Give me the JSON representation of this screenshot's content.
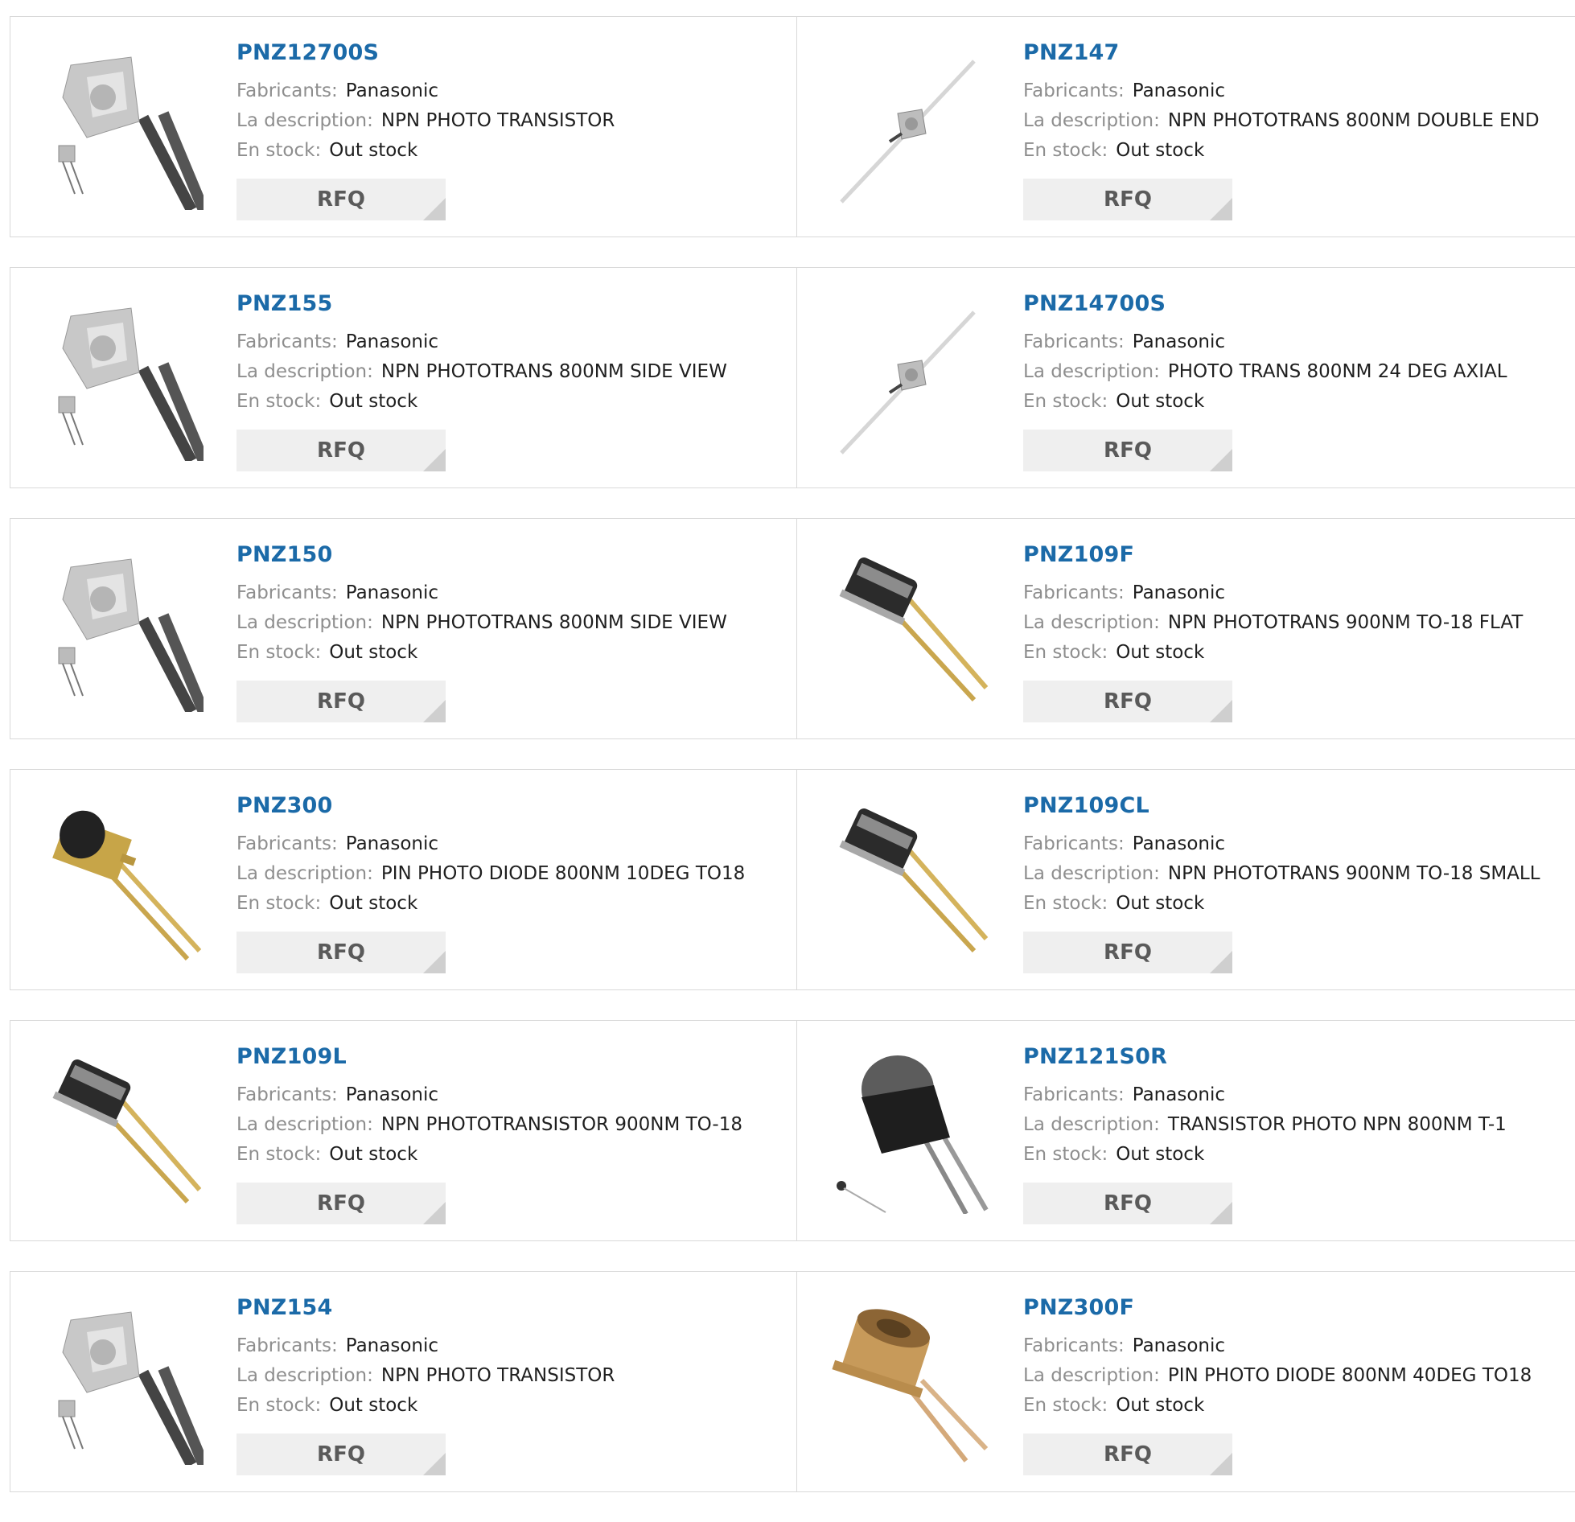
{
  "labels": {
    "manufacturer": "Fabricants:",
    "description": "La description:",
    "stock": "En stock:",
    "rfq": "RFQ"
  },
  "colors": {
    "part_link": "#1b6aa8",
    "label": "#8e8e8e",
    "value": "#1f1f1f",
    "rfq_bg": "#efefef",
    "border": "#d9d9d9"
  },
  "products": [
    {
      "part": "PNZ12700S",
      "manufacturer": "Panasonic",
      "description": "NPN PHOTO TRANSISTOR",
      "stock": "Out stock",
      "image": "side-view-photo-transistor-icon"
    },
    {
      "part": "PNZ147",
      "manufacturer": "Panasonic",
      "description": "NPN PHOTOTRANS 800NM DOUBLE END",
      "stock": "Out stock",
      "image": "axial-phototransistor-icon"
    },
    {
      "part": "PNZ155",
      "manufacturer": "Panasonic",
      "description": "NPN PHOTOTRANS 800NM SIDE VIEW",
      "stock": "Out stock",
      "image": "side-view-photo-transistor-icon"
    },
    {
      "part": "PNZ14700S",
      "manufacturer": "Panasonic",
      "description": "PHOTO TRANS 800NM 24 DEG AXIAL",
      "stock": "Out stock",
      "image": "axial-phototransistor-icon"
    },
    {
      "part": "PNZ150",
      "manufacturer": "Panasonic",
      "description": "NPN PHOTOTRANS 800NM SIDE VIEW",
      "stock": "Out stock",
      "image": "side-view-photo-transistor-icon"
    },
    {
      "part": "PNZ109F",
      "manufacturer": "Panasonic",
      "description": "NPN PHOTOTRANS 900NM TO-18 FLAT",
      "stock": "Out stock",
      "image": "to18-metal-can-icon"
    },
    {
      "part": "PNZ300",
      "manufacturer": "Panasonic",
      "description": "PIN PHOTO DIODE 800NM 10DEG TO18",
      "stock": "Out stock",
      "image": "to18-dome-lens-icon"
    },
    {
      "part": "PNZ109CL",
      "manufacturer": "Panasonic",
      "description": "NPN PHOTOTRANS 900NM TO-18 SMALL",
      "stock": "Out stock",
      "image": "to18-metal-can-icon"
    },
    {
      "part": "PNZ109L",
      "manufacturer": "Panasonic",
      "description": "NPN PHOTOTRANSISTOR 900NM TO-18",
      "stock": "Out stock",
      "image": "to18-metal-can-icon"
    },
    {
      "part": "PNZ121S0R",
      "manufacturer": "Panasonic",
      "description": "TRANSISTOR PHOTO NPN 800NM T-1",
      "stock": "Out stock",
      "image": "t1-dark-package-icon"
    },
    {
      "part": "PNZ154",
      "manufacturer": "Panasonic",
      "description": "NPN PHOTO TRANSISTOR",
      "stock": "Out stock",
      "image": "side-view-photo-transistor-icon"
    },
    {
      "part": "PNZ300F",
      "manufacturer": "Panasonic",
      "description": "PIN PHOTO DIODE 800NM 40DEG TO18",
      "stock": "Out stock",
      "image": "to18-gold-can-icon"
    }
  ]
}
